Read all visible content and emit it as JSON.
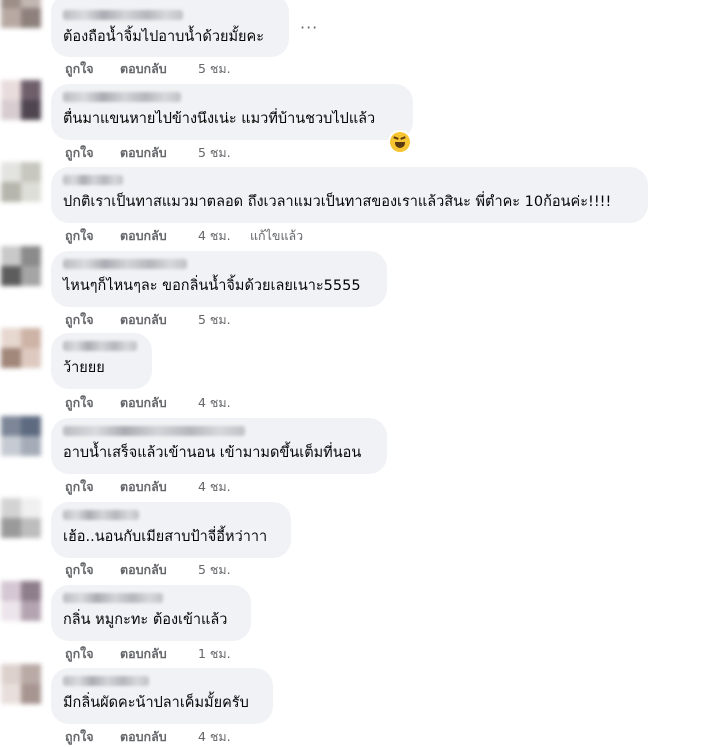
{
  "actions": {
    "like": "ถูกใจ",
    "reply": "ตอบกลับ",
    "edited": "แก้ไขแล้ว"
  },
  "more_options_glyph": "···",
  "comments": [
    {
      "text": "ต้องถือน้ำจิ้มไปอาบน้ำด้วยมั้ยคะ",
      "time": "5 ชม."
    },
    {
      "text": "ตื่นมาแขนหายไปข้างนึงเน่ะ แมวที่บ้านชวบไปแล้ว",
      "time": "5 ชม.",
      "reaction": "laughing-emoji"
    },
    {
      "text": "ปกติเราเป็นทาสแมวมาตลอด ถึงเวลาแมวเป็นทาสของเราแล้วสินะ พี่ตำคะ 10ก้อนค่ะ!!!!",
      "time": "4 ชม.",
      "edited": true
    },
    {
      "text": "ไหนๆก็ไหนๆละ ขอกลิ่นน้ำจิ้มด้วยเลยเนาะ5555",
      "time": "5 ชม."
    },
    {
      "text": "ว้ายยย",
      "time": "4 ชม."
    },
    {
      "text": "อาบน้ำเสร็จแล้วเข้านอน เข้ามามดขึ้นเต็มที่นอน",
      "time": "4 ชม."
    },
    {
      "text": "เฮ้อ..นอนกับเมียสาบป้าจี่อี้หว่าาา",
      "time": "5 ชม."
    },
    {
      "text": "กลิ่น หมูกะทะ ต้องเข้าแล้ว",
      "time": "1 ชม."
    },
    {
      "text": "มีกลิ่นผัดคะน้าปลาเค็มมั้ยครับ",
      "time": "4 ชม."
    }
  ]
}
